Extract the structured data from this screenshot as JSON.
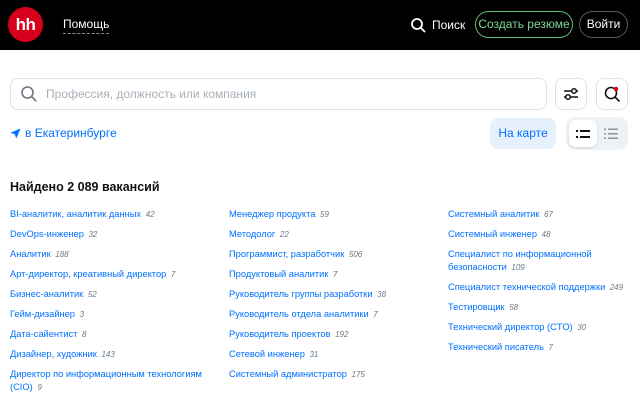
{
  "header": {
    "logo_text": "hh",
    "help_label": "Помощь",
    "search_label": "Поиск",
    "create_resume_label": "Создать резюме",
    "login_label": "Войти"
  },
  "search": {
    "placeholder": "Профессия, должность или компания",
    "value": ""
  },
  "location": {
    "label": "в Екатеринбурге"
  },
  "map_button_label": "На карте",
  "results": {
    "found_text": "Найдено 2 089 вакансий",
    "columns": [
      [
        {
          "name": "BI-аналитик, аналитик данных",
          "count": "42"
        },
        {
          "name": "DevOps-инженер",
          "count": "32"
        },
        {
          "name": "Аналитик",
          "count": "188"
        },
        {
          "name": "Арт-директор, креативный директор",
          "count": "7"
        },
        {
          "name": "Бизнес-аналитик",
          "count": "52"
        },
        {
          "name": "Гейм-дизайнер",
          "count": "3"
        },
        {
          "name": "Дата-сайентист",
          "count": "8"
        },
        {
          "name": "Дизайнер, художник",
          "count": "143"
        },
        {
          "name": "Директор по информационным технологиям (CIO)",
          "count": "9"
        }
      ],
      [
        {
          "name": "Менеджер продукта",
          "count": "59"
        },
        {
          "name": "Методолог",
          "count": "22"
        },
        {
          "name": "Программист, разработчик",
          "count": "506"
        },
        {
          "name": "Продуктовый аналитик",
          "count": "7"
        },
        {
          "name": "Руководитель группы разработки",
          "count": "38"
        },
        {
          "name": "Руководитель отдела аналитики",
          "count": "7"
        },
        {
          "name": "Руководитель проектов",
          "count": "192"
        },
        {
          "name": "Сетевой инженер",
          "count": "31"
        },
        {
          "name": "Системный администратор",
          "count": "175"
        }
      ],
      [
        {
          "name": "Системный аналитик",
          "count": "67"
        },
        {
          "name": "Системный инженер",
          "count": "48"
        },
        {
          "name": "Специалист по информационной безопасности",
          "count": "109"
        },
        {
          "name": "Специалист технической поддержки",
          "count": "249"
        },
        {
          "name": "Тестировщик",
          "count": "58"
        },
        {
          "name": "Технический директор (CTO)",
          "count": "30"
        },
        {
          "name": "Технический писатель",
          "count": "7"
        }
      ]
    ]
  },
  "colors": {
    "brand_red": "#d6001c",
    "link_blue": "#0070ff",
    "resume_green": "#62bf7c",
    "header_bg": "#000000"
  },
  "icons": [
    "search-icon",
    "filters-icon",
    "saved-search-icon",
    "location-arrow-icon",
    "list-view-icon",
    "compact-list-view-icon"
  ]
}
